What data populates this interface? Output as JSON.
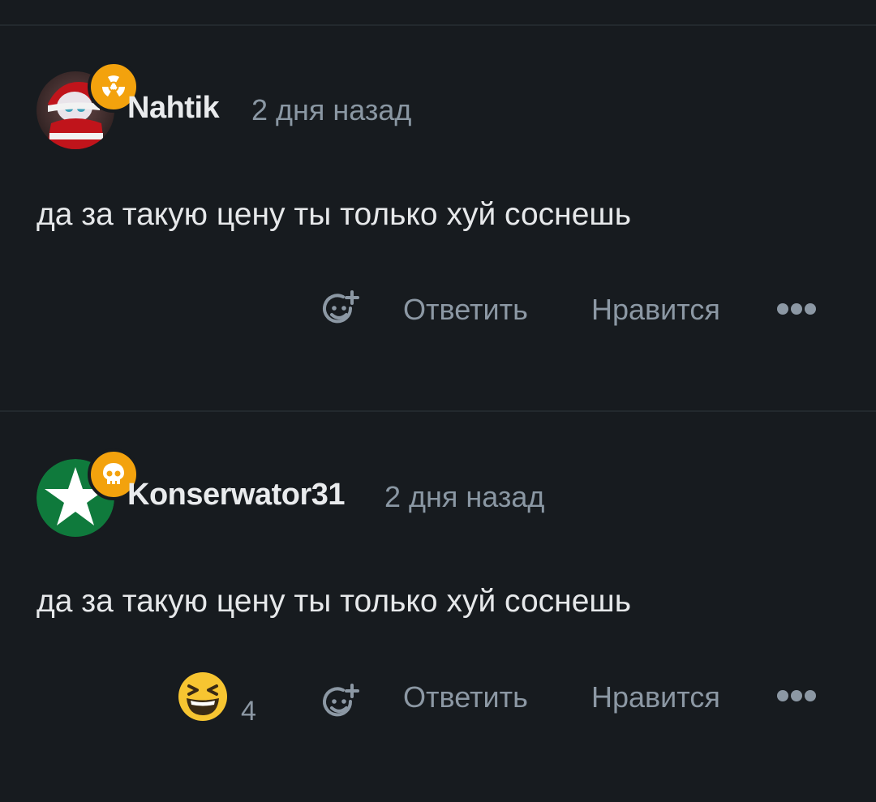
{
  "comments": [
    {
      "username": "Nahtik",
      "time": "2 дня назад",
      "text": "да за такую цену ты только хуй соснешь",
      "badge_icon": "radiation-icon",
      "avatar_icon": "santa-doll-avatar",
      "reply_label": "Ответить",
      "like_label": "Нравится",
      "more_icon": "more-dots-icon",
      "add_reaction_icon": "add-reaction-icon"
    },
    {
      "username": "Konserwator31",
      "time": "2 дня назад",
      "text": "да за такую цену ты только хуй соснешь",
      "badge_icon": "skull-icon",
      "avatar_icon": "green-star-avatar",
      "reaction_emoji": "laughing-emoji",
      "reaction_count": "4",
      "reply_label": "Ответить",
      "like_label": "Нравится",
      "more_icon": "more-dots-icon",
      "add_reaction_icon": "add-reaction-icon"
    }
  ],
  "colors": {
    "background": "#171b1f",
    "badge": "#f3a20d",
    "muted_text": "#8c98a4",
    "primary_text": "#e6e8ea",
    "star_avatar_bg": "#0f7a3c"
  }
}
